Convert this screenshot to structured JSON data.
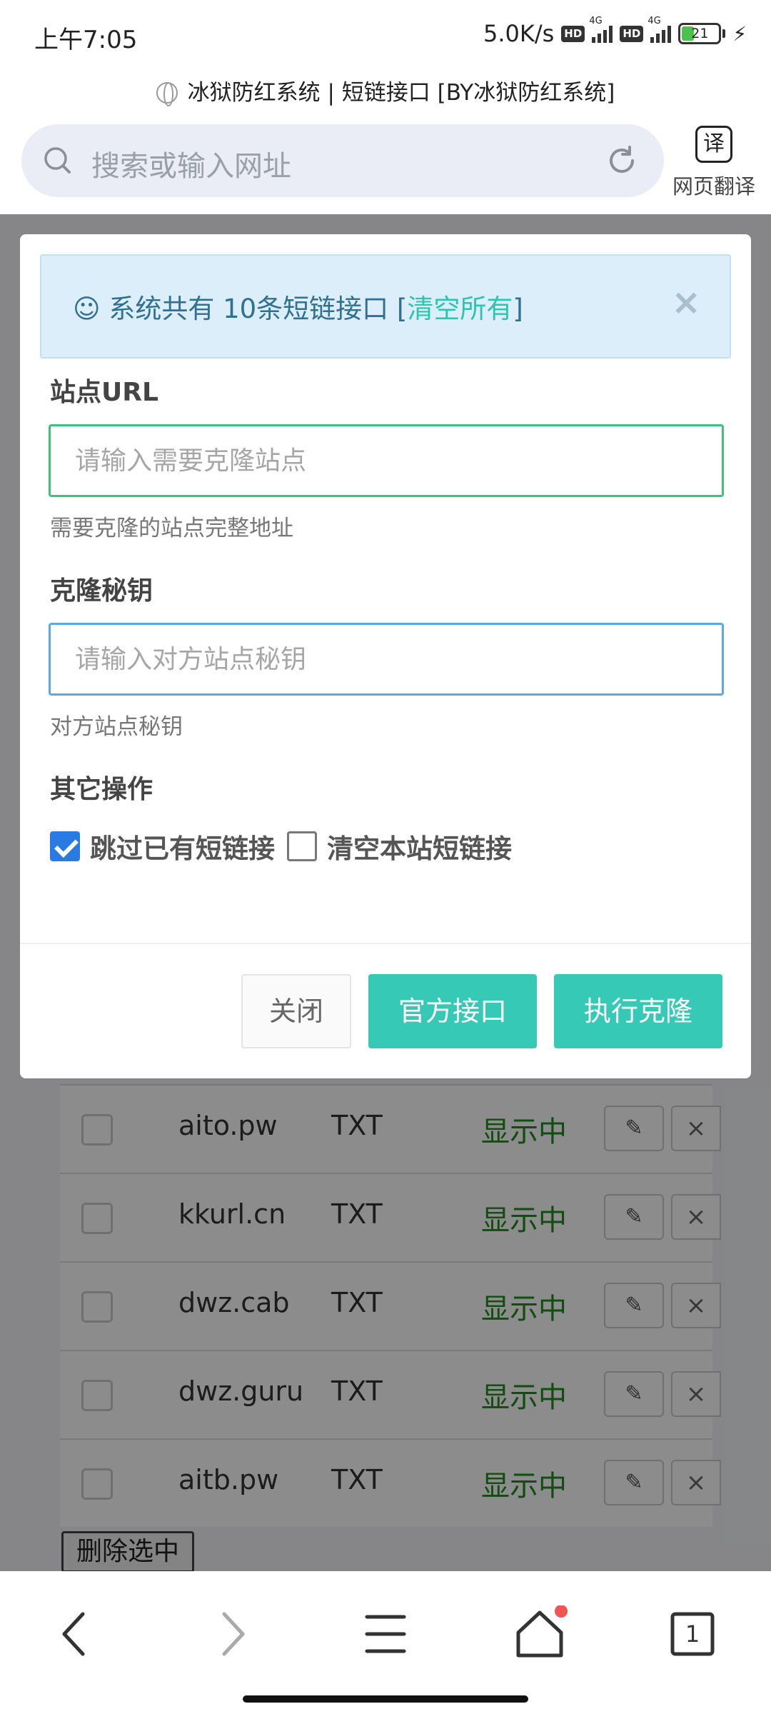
{
  "status_bar": {
    "time": "上午7:05",
    "speed": "5.0K/s",
    "hd": "HD",
    "network": "4G",
    "battery": "21",
    "charging_icon": "bolt-icon"
  },
  "browser": {
    "page_title": "冰狱防红系统 | 短链接口 [BY冰狱防红系统]",
    "search_placeholder": "搜索或输入网址",
    "translate_icon_text": "译",
    "translate_label": "网页翻译"
  },
  "modal": {
    "alert_prefix": "☺ 系统共有 10条短链接口 [",
    "alert_link": "清空所有",
    "alert_suffix": "]",
    "alert_close": "×",
    "url_label": "站点URL",
    "url_placeholder": "请输入需要克隆站点",
    "url_help": "需要克隆的站点完整地址",
    "key_label": "克隆秘钥",
    "key_placeholder": "请输入对方站点秘钥",
    "key_help": "对方站点秘钥",
    "other_label": "其它操作",
    "opt_skip": "跳过已有短链接",
    "opt_skip_checked": true,
    "opt_clear": "清空本站短链接",
    "opt_clear_checked": false,
    "btn_close": "关闭",
    "btn_official": "官方接口",
    "btn_clone": "执行克隆"
  },
  "table": {
    "rows": [
      {
        "domain": "aito.pw",
        "type": "TXT",
        "status": "显示中"
      },
      {
        "domain": "kkurl.cn",
        "type": "TXT",
        "status": "显示中"
      },
      {
        "domain": "dwz.cab",
        "type": "TXT",
        "status": "显示中"
      },
      {
        "domain": "dwz.guru",
        "type": "TXT",
        "status": "显示中"
      },
      {
        "domain": "aitb.pw",
        "type": "TXT",
        "status": "显示中"
      }
    ],
    "delete_selected": "删除选中"
  },
  "bottom_nav": {
    "tabs_count": "1"
  },
  "colors": {
    "accent": "#36c9b5",
    "status_green": "#1f8c1f",
    "alert_bg": "#dbeefa",
    "checkbox_blue": "#2a7ae4"
  }
}
